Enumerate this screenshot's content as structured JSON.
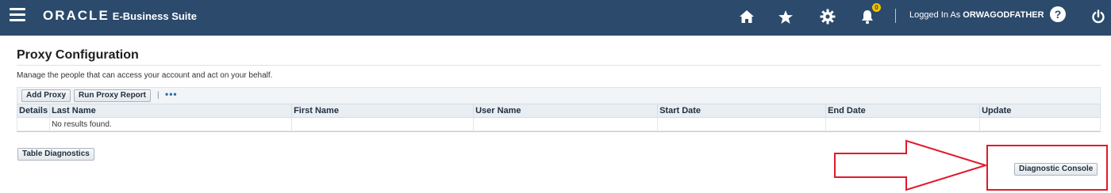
{
  "header": {
    "brand_oracle": "ORACLE",
    "brand_suite": "E-Business Suite",
    "notifications_count": "0",
    "logged_in_prefix": "Logged In As ",
    "logged_in_user": "ORWAGODFATHER",
    "help_label": "?",
    "icons": [
      "menu-icon",
      "home-icon",
      "star-icon",
      "gear-icon",
      "bell-icon",
      "help-icon",
      "power-icon"
    ],
    "colors": {
      "bar": "#2b4a6c",
      "badge": "#f3c400"
    }
  },
  "page": {
    "title": "Proxy Configuration",
    "instruction": "Manage the people that can access your account and act on your behalf."
  },
  "toolbar": {
    "add_proxy": "Add Proxy",
    "run_proxy_report": "Run Proxy Report",
    "separator": "|",
    "more": "•••"
  },
  "table": {
    "columns": [
      "Details",
      "Last Name",
      "First Name",
      "User Name",
      "Start Date",
      "End Date",
      "Update"
    ],
    "empty_message": "No results found."
  },
  "actions": {
    "table_diagnostics": "Table Diagnostics",
    "diagnostic_console": "Diagnostic Console"
  },
  "annotation": {
    "color": "#e1192b"
  }
}
